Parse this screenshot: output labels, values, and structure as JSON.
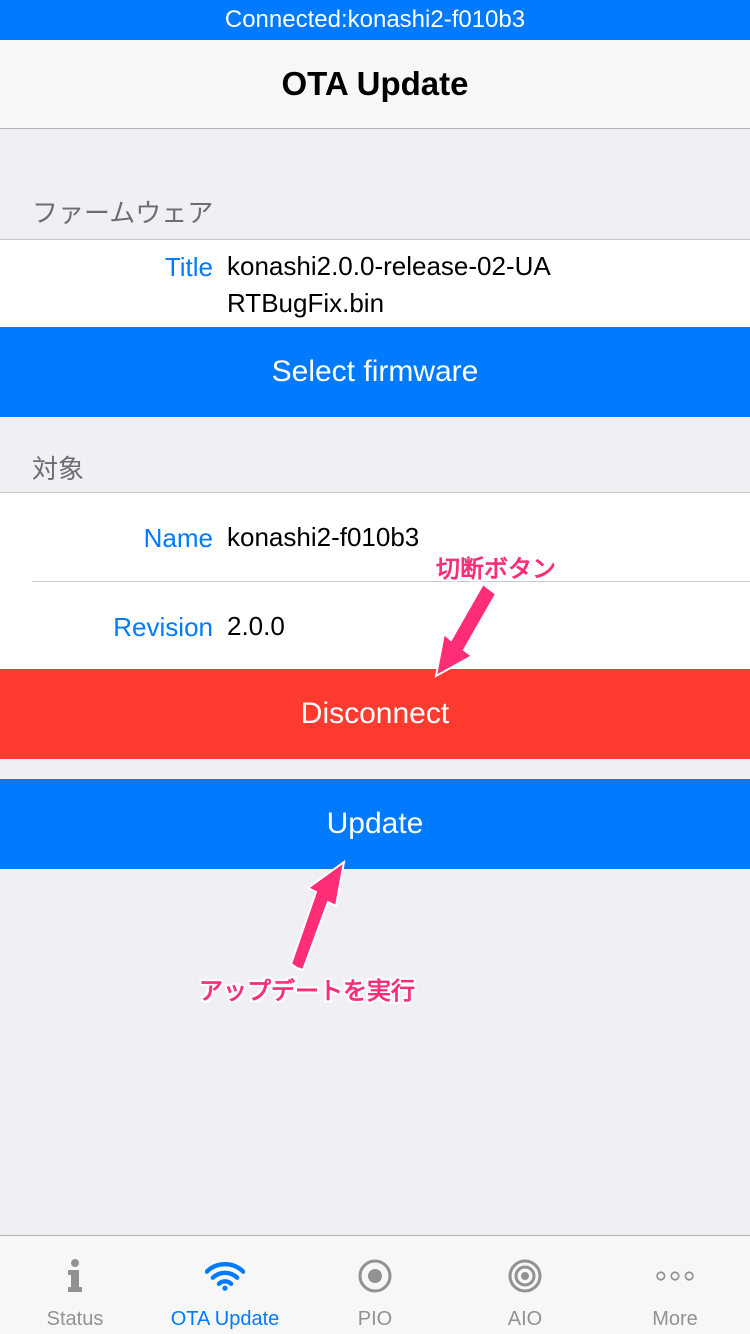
{
  "status_bar": {
    "text": "Connected:konashi2-f010b3"
  },
  "nav": {
    "title": "OTA Update"
  },
  "firmware_section": {
    "header": "ファームウェア",
    "title_label": "Title",
    "title_value": "konashi2.0.0-release-02-UARTBugFix.bin",
    "select_button": "Select firmware"
  },
  "target_section": {
    "header": "対象",
    "name_label": "Name",
    "name_value": "konashi2-f010b3",
    "revision_label": "Revision",
    "revision_value": "2.0.0",
    "disconnect_button": "Disconnect"
  },
  "update_button": "Update",
  "annotations": {
    "disconnect_note": "切断ボタン",
    "update_note": "アップデートを実行"
  },
  "tabs": [
    {
      "label": "Status",
      "icon": "info-icon",
      "active": false
    },
    {
      "label": "OTA Update",
      "icon": "wifi-icon",
      "active": true
    },
    {
      "label": "PIO",
      "icon": "radio-icon",
      "active": false
    },
    {
      "label": "AIO",
      "icon": "target-icon",
      "active": false
    },
    {
      "label": "More",
      "icon": "more-icon",
      "active": false
    }
  ],
  "colors": {
    "accent": "#007aff",
    "destructive": "#ff3b30",
    "annotation": "#ff2d75",
    "inactive_tab": "#929292"
  }
}
